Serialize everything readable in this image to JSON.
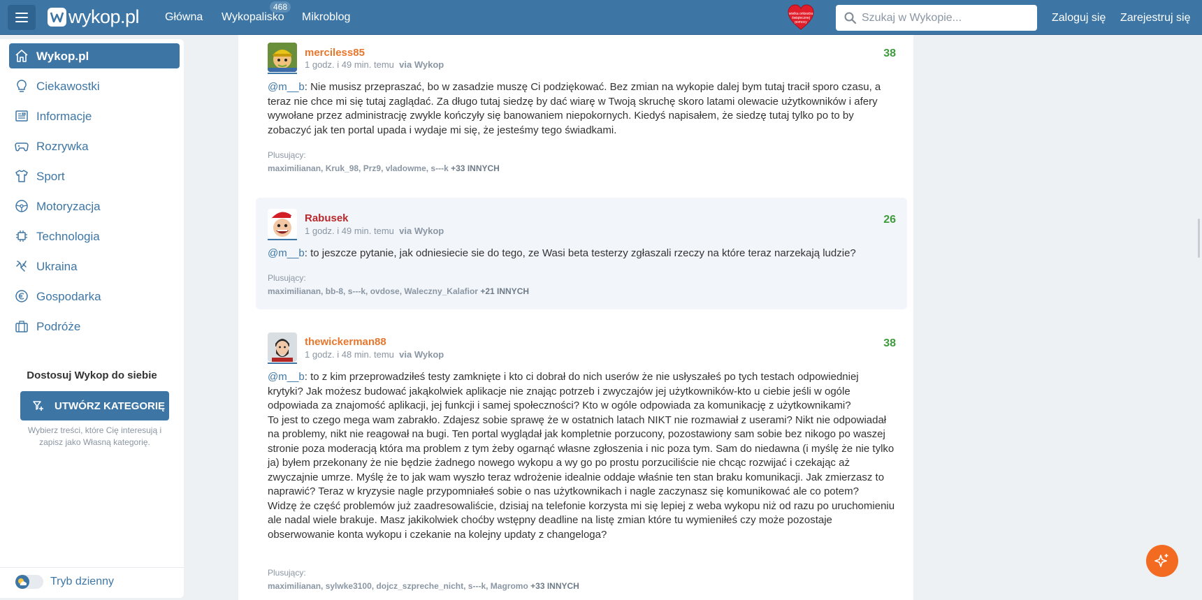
{
  "header": {
    "logo_text": "wykop.pl",
    "nav": [
      {
        "label": "Główna"
      },
      {
        "label": "Wykopalisko",
        "badge": "468"
      },
      {
        "label": "Mikroblog"
      }
    ],
    "search_placeholder": "Szukaj w Wykopie...",
    "login": "Zaloguj się",
    "register": "Zarejestruj się",
    "heart_text": "wielka orkiestra świątecznej pomocy"
  },
  "sidebar": {
    "items": [
      {
        "label": "Wykop.pl",
        "icon": "home-icon"
      },
      {
        "label": "Ciekawostki",
        "icon": "lightbulb-icon"
      },
      {
        "label": "Informacje",
        "icon": "newspaper-icon"
      },
      {
        "label": "Rozrywka",
        "icon": "gamepad-icon"
      },
      {
        "label": "Sport",
        "icon": "shirt-icon"
      },
      {
        "label": "Motoryzacja",
        "icon": "steering-wheel-icon"
      },
      {
        "label": "Technologia",
        "icon": "chip-icon"
      },
      {
        "label": "Ukraina",
        "icon": "ukraine-icon"
      },
      {
        "label": "Gospodarka",
        "icon": "euro-coin-icon"
      },
      {
        "label": "Podróże",
        "icon": "suitcase-icon"
      }
    ],
    "customize_title": "Dostosuj Wykop do siebie",
    "customize_button": "UTWÓRZ KATEGORIĘ",
    "customize_desc": "Wybierz treści, które Cię interesują i zapisz jako Własną kategorię.",
    "theme_toggle": "Tryb dzienny"
  },
  "posts": [
    {
      "username": "merciless85",
      "time": "1 godz. i 49 min. temu",
      "via": "via Wykop",
      "score": "38",
      "mention": "@m__b",
      "text": ": Nie musisz przepraszać, bo w zasadzie muszę Ci podziękować. Bez zmian na wykopie dalej bym tutaj tracił sporo czasu, a teraz nie chce mi się tutaj zaglądać. Za długo tutaj siedzę by dać wiarę w Twoją skruchę skoro latami olewacie użytkowników i afery wywołane przez administrację zwykle kończyły się banowaniem niepokornych. Kiedyś napisałem, że siedzę tutaj tylko po to by zobaczyć jak ten portal upada i wydaje mi się, że jesteśmy tego świadkami.",
      "plus_label": "Plusujący:",
      "plus_users": "maximilianan, Kruk_98, Prz9, vladowme, s---k",
      "plus_more": "+33 INNYCH"
    },
    {
      "username": "Rabusek",
      "time": "1 godz. i 49 min. temu",
      "via": "via Wykop",
      "score": "26",
      "mention": "@m__b",
      "text": ": to jeszcze pytanie, jak odniesiecie sie do tego, ze Wasi beta testerzy zgłaszali rzeczy na które teraz narzekają ludzie?",
      "plus_label": "Plusujący:",
      "plus_users": "maximilianan, bb-8, s---k, ovdose, Waleczny_Kalafior",
      "plus_more": "+21 INNYCH"
    },
    {
      "username": "thewickerman88",
      "time": "1 godz. i 48 min. temu",
      "via": "via Wykop",
      "score": "38",
      "mention": "@m__b",
      "text": ": to z kim przeprowadziłeś testy zamknięte i kto ci dobrał do nich userów że nie usłyszałeś po tych testach odpowiedniej krytyki? Jak możesz budować jakąkolwiek aplikacje nie znając potrzeb i zwyczajów jej użytkowników-kto u ciebie jeśli w ogóle odpowiada za znajomość aplikacji, jej funkcji i samej społeczności? Kto w ogóle odpowiada za komunikację z użytkownikami?",
      "text2": "To jest to czego mega wam zabrakło. Zdajesz sobie sprawę że w ostatnich latach NIKT nie rozmawiał z userami? Nikt nie odpowiadał na problemy, nikt nie reagował na bugi. Ten portal wyglądał jak kompletnie porzucony, pozostawiony sam sobie bez nikogo po waszej stronie poza moderacją która ma problem z tym żeby ogarnąć własne zgłoszenia i nic poza tym. Sam do niedawna (i myślę że nie tylko ja) byłem przekonany że nie będzie żadnego nowego wykopu a wy go po prostu porzuciliście nie chcąc rozwijać i czekając aż zwyczajnie umrze. Myślę że to jak wam wyszło teraz wdrożenie idealnie oddaje właśnie ten stan braku komunikacji. Jak zmierzasz to naprawić? Teraz w kryzysie nagle przypomniałeś sobie o nas użytkownikach i nagle zaczynasz się komunikować ale co potem?",
      "text3": "Widzę że część problemów już zaadresowaliście, dzisiaj na telefonie korzysta mi się lepiej z weba wykopu niż od razu po uruchomieniu ale nadal wiele brakuje. Masz jakikolwiek choćby wstępny deadline na listę zmian które tu wymieniłeś czy może pozostaje obserwowanie konta wykopu i czekanie na kolejny updaty z changeloga?",
      "plus_label": "Plusujący:",
      "plus_users": "maximilianan, sylwke3100, dojcz_szpreche_nicht, s---k, Magromo",
      "plus_more": "+33 INNYCH"
    }
  ],
  "colors": {
    "brand": "#3d76a5",
    "accent_orange": "#e8762c",
    "score_green": "#3e9b3c",
    "fab": "#f26b21"
  }
}
